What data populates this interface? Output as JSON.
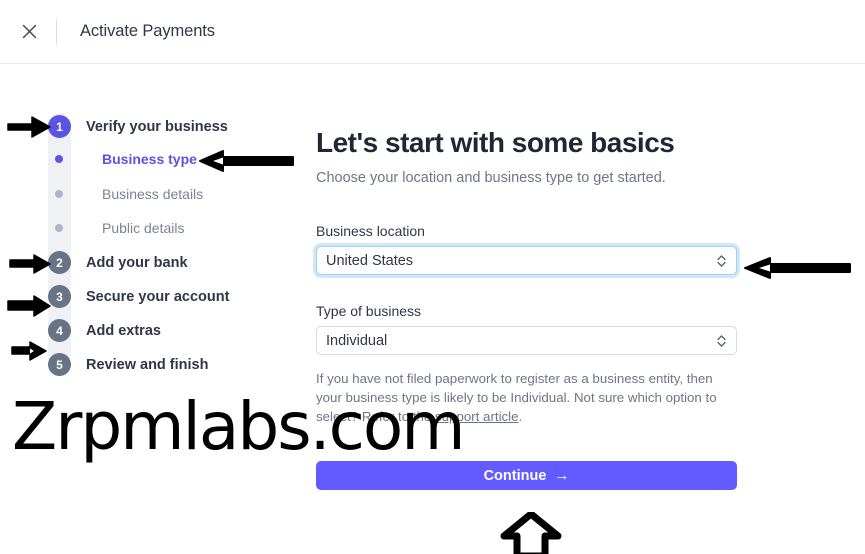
{
  "header": {
    "close_icon": "close-icon",
    "title": "Activate Payments"
  },
  "sidebar": {
    "steps": [
      {
        "number": "1",
        "label": "Verify your business",
        "active": true
      },
      {
        "number": "2",
        "label": "Add your bank",
        "active": false
      },
      {
        "number": "3",
        "label": "Secure your account",
        "active": false
      },
      {
        "number": "4",
        "label": "Add extras",
        "active": false
      },
      {
        "number": "5",
        "label": "Review and finish",
        "active": false
      }
    ],
    "substeps": [
      {
        "label": "Business type",
        "active": true
      },
      {
        "label": "Business details",
        "active": false
      },
      {
        "label": "Public details",
        "active": false
      }
    ]
  },
  "main": {
    "title": "Let's start with some basics",
    "subtitle": "Choose your location and business type to get started.",
    "business_location": {
      "label": "Business location",
      "value": "United States",
      "icon": "stepper-chevron-icon"
    },
    "type_of_business": {
      "label": "Type of business",
      "value": "Individual",
      "icon": "stepper-chevron-icon"
    },
    "helper_text_before": "If you have not filed paperwork to register as a business entity, then your business type is likely to be Individual. Not sure which option to select? Refer to the ",
    "helper_link": "support article",
    "helper_text_after": ".",
    "continue_label": "Continue",
    "continue_arrow": "→"
  },
  "watermark": {
    "text": "Zrpmlabs.com"
  },
  "colors": {
    "accent_purple": "#635bff",
    "step_active": "#5b53e3",
    "step_inactive": "#697386",
    "focus_ring": "#cfe8f7",
    "text_dark": "#2f3747",
    "text_muted": "#6d7588"
  }
}
